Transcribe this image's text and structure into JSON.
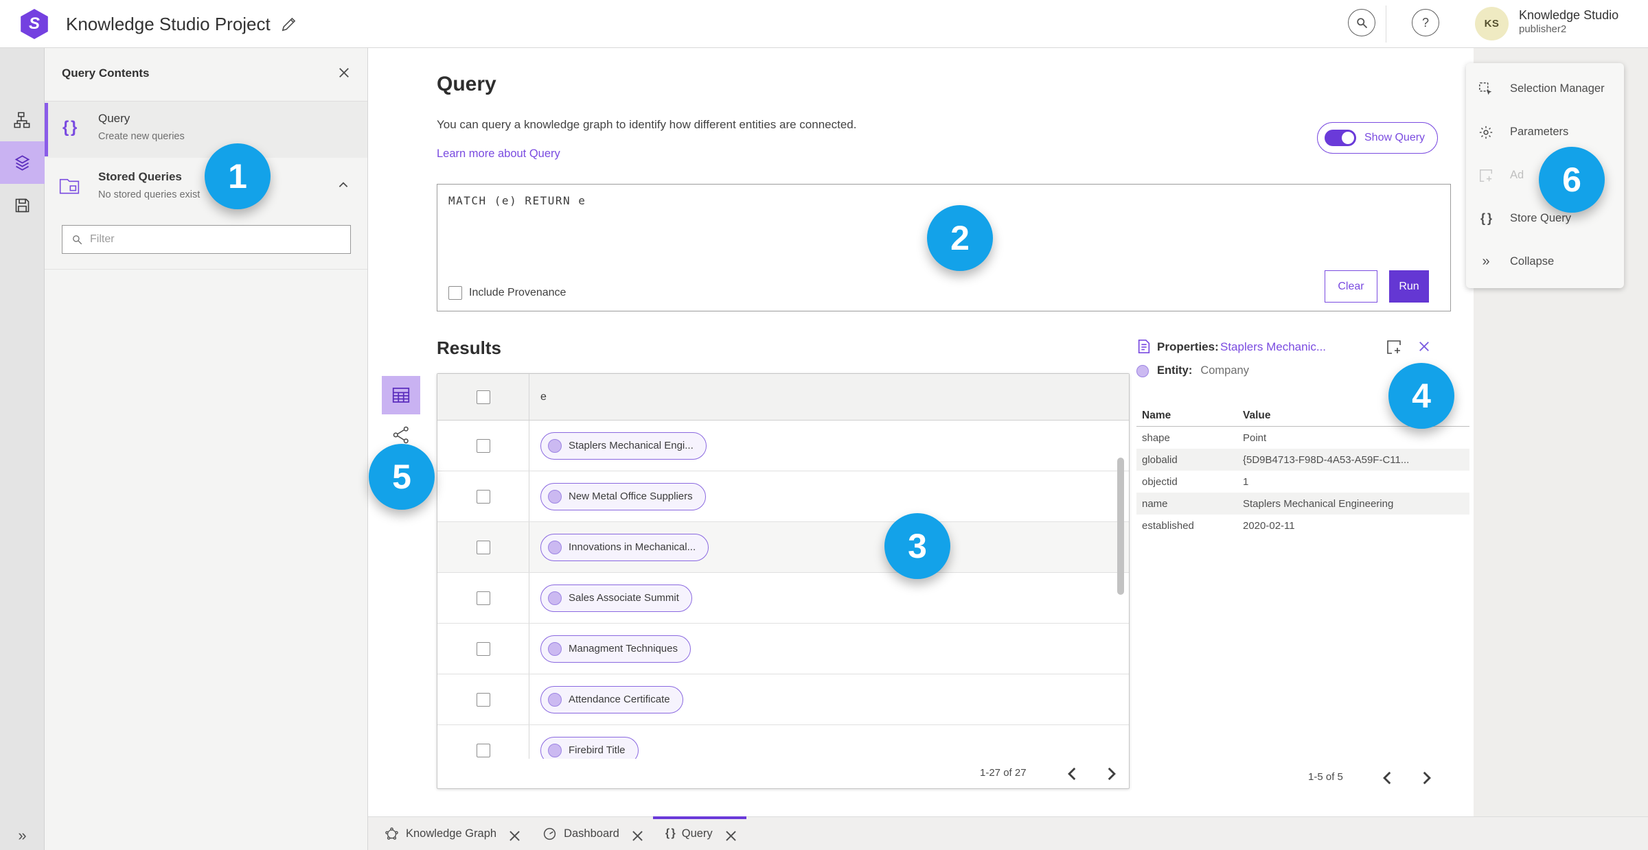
{
  "topbar": {
    "title": "Knowledge Studio Project",
    "user_name": "Knowledge Studio",
    "user_role": "publisher2",
    "avatar_initials": "KS",
    "help_glyph": "?"
  },
  "query_contents": {
    "title": "Query Contents",
    "query_item": {
      "title": "Query",
      "subtitle": "Create new queries"
    },
    "stored_item": {
      "title": "Stored Queries",
      "subtitle": "No stored queries exist"
    },
    "filter_placeholder": "Filter"
  },
  "query_panel": {
    "title": "Query",
    "description": "You can query a knowledge graph to identify how different entities are connected.",
    "learn_more": "Learn more about Query",
    "show_query_label": "Show Query",
    "code": "MATCH (e) RETURN e",
    "include_provenance": "Include Provenance",
    "clear_label": "Clear",
    "run_label": "Run"
  },
  "results": {
    "title": "Results",
    "column": "e",
    "rows": [
      "Staplers Mechanical Engi...",
      "New Metal Office Suppliers",
      "Innovations in Mechanical...",
      "Sales Associate Summit",
      "Managment Techniques",
      "Attendance Certificate",
      "Firebird Title"
    ],
    "pagination": "1-27 of 27"
  },
  "properties": {
    "label": "Properties:",
    "link": "Staplers Mechanic...",
    "entity_label": "Entity:",
    "entity_value": "Company",
    "col_name": "Name",
    "col_value": "Value",
    "rows": [
      {
        "name": "shape",
        "value": "Point"
      },
      {
        "name": "globalid",
        "value": "{5D9B4713-F98D-4A53-A59F-C11..."
      },
      {
        "name": "objectid",
        "value": "1"
      },
      {
        "name": "name",
        "value": "Staplers Mechanical Engineering"
      },
      {
        "name": "established",
        "value": "2020-02-11"
      }
    ],
    "pagination": "1-5 of 5"
  },
  "right_menu": {
    "items": [
      {
        "label": "Selection Manager"
      },
      {
        "label": "Parameters"
      },
      {
        "label": "Ad"
      },
      {
        "label": "Store Query"
      },
      {
        "label": "Collapse"
      }
    ]
  },
  "tabs": [
    {
      "label": "Knowledge Graph"
    },
    {
      "label": "Dashboard"
    },
    {
      "label": "Query"
    }
  ],
  "badges": [
    "1",
    "2",
    "3",
    "4",
    "5",
    "6"
  ],
  "colors": {
    "accent": "#6a3ad9",
    "badge": "#13a2e9",
    "rail_selected": "#c9b2f2",
    "pill_border": "#8a68e0"
  }
}
